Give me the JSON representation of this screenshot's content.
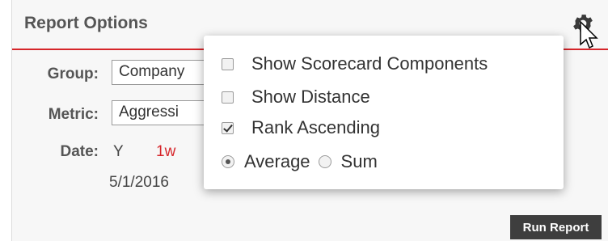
{
  "panel": {
    "title": "Report Options",
    "icons": {
      "gear": "gear-icon",
      "cursor": "mouse-pointer-icon"
    }
  },
  "form": {
    "group_label": "Group:",
    "group_value": "Company",
    "metric_label": "Metric:",
    "metric_value": "Aggressi",
    "date_label": "Date:",
    "date_options": [
      "Y",
      "1w"
    ],
    "date_value": "5/1/2016"
  },
  "popover": {
    "show_scorecard_components": {
      "label": "Show Scorecard Components",
      "checked": false
    },
    "show_distance": {
      "label": "Show Distance",
      "checked": false
    },
    "rank_ascending": {
      "label": "Rank Ascending",
      "checked": true
    },
    "aggregation": {
      "options": [
        "Average",
        "Sum"
      ],
      "selected": "Average"
    }
  },
  "actions": {
    "run_report": "Run Report"
  },
  "colors": {
    "accent": "#d6252a",
    "button": "#3e3e3e",
    "date_active": "#d6252a"
  }
}
